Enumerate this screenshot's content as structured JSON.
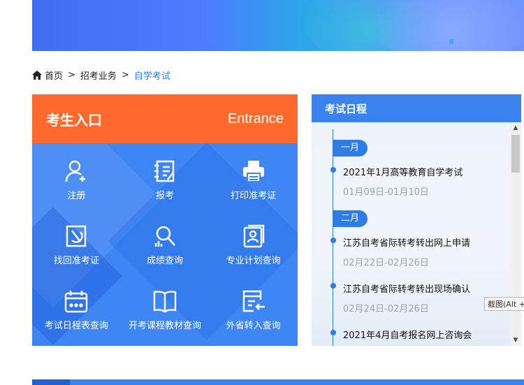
{
  "breadcrumb": {
    "home": "首页",
    "level1": "招考业务",
    "current": "自学考试",
    "separator": ">"
  },
  "entrance": {
    "title_cn": "考生入口",
    "title_en": "Entrance",
    "items": [
      {
        "label": "注册",
        "icon": "register-user-icon"
      },
      {
        "label": "报考",
        "icon": "apply-form-icon"
      },
      {
        "label": "打印准考证",
        "icon": "printer-icon"
      },
      {
        "label": "找回准考证",
        "icon": "retrieve-card-icon"
      },
      {
        "label": "成绩查询",
        "icon": "score-search-icon"
      },
      {
        "label": "专业计划查询",
        "icon": "major-plan-icon"
      },
      {
        "label": "考试日程表查询",
        "icon": "calendar-icon"
      },
      {
        "label": "开考课程教材查询",
        "icon": "book-icon"
      },
      {
        "label": "外省转入查询",
        "icon": "transfer-in-icon"
      }
    ]
  },
  "schedule": {
    "title": "考试日程",
    "months": [
      "一月",
      "二月"
    ],
    "events": [
      {
        "title": "2021年1月高等教育自学考试",
        "date": "01月09日-01月10日"
      },
      {
        "title": "江苏自考省际转考转出网上申请",
        "date": "02月22日-02月26日"
      },
      {
        "title": "江苏自考省际转考转出现场确认",
        "date": "02月24日-02月26日"
      },
      {
        "title": "2021年4月自考报名网上咨询会",
        "date": ""
      }
    ]
  },
  "tooltip": "截图(Alt +",
  "colors": {
    "orange": "#ff6a2c",
    "blue_panel": "#3f86f5",
    "accent_blue": "#2f7ce5"
  }
}
